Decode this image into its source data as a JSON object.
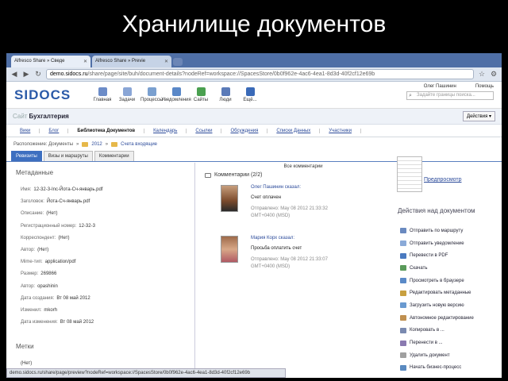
{
  "slide_title": "Хранилище документов",
  "browser": {
    "tabs": [
      {
        "label": "Alfresco Share » Сведе"
      },
      {
        "label": "Alfresco Share » Previe"
      }
    ],
    "url_domain": "demo.sidocs.ru",
    "url_path": "/share/page/site/buh/document-details?nodeRef=workspace://SpacesStore/0b0f962e-4ac6-4ea1-8d3d-40f2cf12e69b"
  },
  "app": {
    "logo_main": "SI",
    "logo_accent": "DOCS",
    "nav": [
      {
        "label": "Главная",
        "color": "#6c8cc8"
      },
      {
        "label": "Задачи",
        "color": "#8aa6d6"
      },
      {
        "label": "Процессы",
        "color": "#7aa0d0"
      },
      {
        "label": "Уведомления",
        "color": "#5a88c8"
      },
      {
        "label": "Сайты",
        "color": "#4aa050"
      },
      {
        "label": "Люди",
        "color": "#5a7ab8"
      },
      {
        "label": "Ещё...",
        "color": "#3a6ab8"
      }
    ],
    "user": "Олег Пашинин",
    "help": "Помощь",
    "search_placeholder": "Задайте границы поиска..."
  },
  "site": {
    "prefix": "Сайт",
    "name": "Бухгалтерия",
    "actions_button": "Действия ▾",
    "nav": [
      "Вики",
      "Блог",
      "Библиотека Документов",
      "Календарь",
      "Ссылки",
      "Обсуждения",
      "Списки Данных",
      "Участники"
    ],
    "current_nav": 2
  },
  "breadcrumb": {
    "label": "Расположение: Документы",
    "sep": "»",
    "year": "2012",
    "folder": "Счета входящие"
  },
  "doc_tabs": [
    "Ревизиты",
    "Визы и маршруты",
    "Комментарии"
  ],
  "metadata": {
    "title": "Метаданные",
    "rows": [
      {
        "k": "Имя:",
        "v": "12-32-3-Inc-Йота-Сч-январь.pdf"
      },
      {
        "k": "Заголовок:",
        "v": "Йота-Сч-январь.pdf"
      },
      {
        "k": "Описание:",
        "v": "(Нет)"
      },
      {
        "k": "Регистрационный номер:",
        "v": "12-32-3"
      },
      {
        "k": "Корреспондент:",
        "v": "(Нет)"
      },
      {
        "k": "Автор:",
        "v": "(Нет)"
      },
      {
        "k": "Mime-тип:",
        "v": "application/pdf"
      },
      {
        "k": "Размер:",
        "v": "269866"
      },
      {
        "k": "Автор:",
        "v": "opashinin"
      },
      {
        "k": "Дата создания:",
        "v": "Вт 08 май 2012"
      },
      {
        "k": "Изменил:",
        "v": "mkorh"
      },
      {
        "k": "Дата изменения:",
        "v": "Вт 08 май 2012"
      }
    ],
    "tags_title": "Метки",
    "tags_value": "(Нет)"
  },
  "comments": {
    "all_link": "Все комментарии",
    "title": "Комментарии (2/2)",
    "items": [
      {
        "who": "Олег Пашинин сказал:",
        "text": "Счет оплачен",
        "date1": "Отправлено: May 08 2012 21:33:32",
        "date2": "GMT+0400 (MSD)"
      },
      {
        "who": "Мария Корх сказал:",
        "text": "Просьба оплатить счет",
        "date1": "Отправлено: May 08 2012 21:33:07",
        "date2": "GMT+0400 (MSD)"
      }
    ]
  },
  "doc_actions": {
    "preview_link": "Предпросмотр",
    "title": "Действия над документом",
    "items": [
      {
        "label": "Отправить по маршруту",
        "color": "#6a8ac0"
      },
      {
        "label": "Отправить уведомление",
        "color": "#8aaad8"
      },
      {
        "label": "Перевести в PDF",
        "color": "#4a7ac0"
      },
      {
        "label": "Скачать",
        "color": "#5a9a5a"
      },
      {
        "label": "Просмотреть в браузере",
        "color": "#5a8ac8"
      },
      {
        "label": "Редактировать метаданные",
        "color": "#c8a040"
      },
      {
        "label": "Загрузить новую версию",
        "color": "#6a9ad0"
      },
      {
        "label": "Автономное редактирование",
        "color": "#c09050"
      },
      {
        "label": "Копировать в ...",
        "color": "#7a8ab0"
      },
      {
        "label": "Перенести в ...",
        "color": "#8a7ab0"
      },
      {
        "label": "Удалить документ",
        "color": "#a0a0a0"
      },
      {
        "label": "Начать бизнес-процесс",
        "color": "#5a8ac0"
      },
      {
        "label": "Управление правами",
        "color": "#c86060"
      }
    ]
  },
  "status_url": "demo.sidocs.ru/share/page/preview?nodeRef=workspace://SpacesStore/0b0f962e-4ac6-4ea1-8d3d-40f2cf12e69b"
}
